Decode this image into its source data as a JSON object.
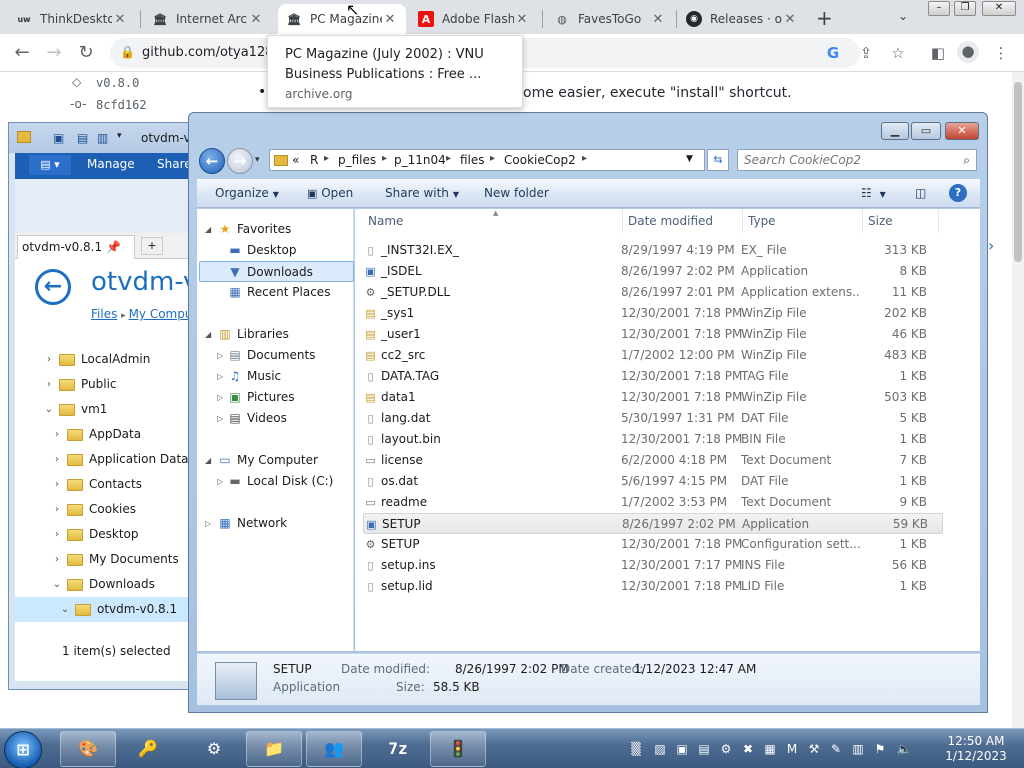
{
  "browser": {
    "tabs": [
      {
        "title": "ThinkDeskto",
        "favicon": "uw-icon"
      },
      {
        "title": "Internet Arch",
        "favicon": "archive-icon"
      },
      {
        "title": "PC Magazine",
        "favicon": "archive-icon"
      },
      {
        "title": "Adobe Flash",
        "favicon": "adobe-icon"
      },
      {
        "title": "FavesToGo",
        "favicon": "globe-icon"
      },
      {
        "title": "Releases · ot",
        "favicon": "github-icon"
      }
    ],
    "new_tab": "+",
    "url": "github.com/otya128",
    "tooltip": {
      "title": "PC Magazine (July 2002) : VNU Business Publications : Free ...",
      "domain": "archive.org"
    }
  },
  "github": {
    "tag": "v0.8.0",
    "commit": "8cfd162",
    "text": "ome easier, execute \"install\" shortcut."
  },
  "bg_explorer": {
    "ribbon_tabs": [
      "Manage",
      "Share"
    ],
    "title_fragment": "otvdm-v",
    "tab_label": "otvdm-v0.8.1",
    "add_tab": "+",
    "big_title": "otvdm-v0",
    "breadcrumb": [
      "Files",
      "My Comput"
    ],
    "tree": [
      {
        "label": "LocalAdmin",
        "depth": 0
      },
      {
        "label": "Public",
        "depth": 0
      },
      {
        "label": "vm1",
        "depth": 0
      },
      {
        "label": "AppData",
        "depth": 1
      },
      {
        "label": "Application Data",
        "depth": 1
      },
      {
        "label": "Contacts",
        "depth": 1
      },
      {
        "label": "Cookies",
        "depth": 1
      },
      {
        "label": "Desktop",
        "depth": 1
      },
      {
        "label": "My Documents",
        "depth": 1
      },
      {
        "label": "Downloads",
        "depth": 1
      },
      {
        "label": "otvdm-v0.8.1",
        "depth": 2
      }
    ],
    "status": "1 item(s) selected"
  },
  "explorer": {
    "breadcrumb": [
      "«",
      "R",
      "p_files",
      "p_11n04",
      "files",
      "CookieCop2"
    ],
    "search_placeholder": "Search CookieCop2",
    "commands": {
      "organize": "Organize",
      "open": "Open",
      "share_with": "Share with",
      "new_folder": "New folder"
    },
    "nav": {
      "favorites": "Favorites",
      "desktop": "Desktop",
      "downloads": "Downloads",
      "recent_places": "Recent Places",
      "libraries": "Libraries",
      "documents": "Documents",
      "music": "Music",
      "pictures": "Pictures",
      "videos": "Videos",
      "my_computer": "My Computer",
      "local_disk": "Local Disk (C:)",
      "network": "Network"
    },
    "columns": {
      "name": "Name",
      "date": "Date modified",
      "type": "Type",
      "size": "Size"
    },
    "files": [
      {
        "name": "_INST32I.EX_",
        "date": "8/29/1997 4:19 PM",
        "type": "EX_ File",
        "size": "313 KB",
        "icon": "file-icon"
      },
      {
        "name": "_ISDEL",
        "date": "8/26/1997 2:02 PM",
        "type": "Application",
        "size": "8 KB",
        "icon": "app-icon"
      },
      {
        "name": "_SETUP.DLL",
        "date": "8/26/1997 2:01 PM",
        "type": "Application extens...",
        "size": "11 KB",
        "icon": "dll-icon"
      },
      {
        "name": "_sys1",
        "date": "12/30/2001 7:18 PM",
        "type": "WinZip File",
        "size": "202 KB",
        "icon": "zip-icon"
      },
      {
        "name": "_user1",
        "date": "12/30/2001 7:18 PM",
        "type": "WinZip File",
        "size": "46 KB",
        "icon": "zip-icon"
      },
      {
        "name": "cc2_src",
        "date": "1/7/2002 12:00 PM",
        "type": "WinZip File",
        "size": "483 KB",
        "icon": "zip-icon"
      },
      {
        "name": "DATA.TAG",
        "date": "12/30/2001 7:18 PM",
        "type": "TAG File",
        "size": "1 KB",
        "icon": "file-icon"
      },
      {
        "name": "data1",
        "date": "12/30/2001 7:18 PM",
        "type": "WinZip File",
        "size": "503 KB",
        "icon": "zip-icon"
      },
      {
        "name": "lang.dat",
        "date": "5/30/1997 1:31 PM",
        "type": "DAT File",
        "size": "5 KB",
        "icon": "file-icon"
      },
      {
        "name": "layout.bin",
        "date": "12/30/2001 7:18 PM",
        "type": "BIN File",
        "size": "1 KB",
        "icon": "file-icon"
      },
      {
        "name": "license",
        "date": "6/2/2000 4:18 PM",
        "type": "Text Document",
        "size": "7 KB",
        "icon": "text-icon"
      },
      {
        "name": "os.dat",
        "date": "5/6/1997 4:15 PM",
        "type": "DAT File",
        "size": "1 KB",
        "icon": "file-icon"
      },
      {
        "name": "readme",
        "date": "1/7/2002 3:53 PM",
        "type": "Text Document",
        "size": "9 KB",
        "icon": "text-icon"
      },
      {
        "name": "SETUP",
        "date": "8/26/1997 2:02 PM",
        "type": "Application",
        "size": "59 KB",
        "icon": "app-icon",
        "selected": true
      },
      {
        "name": "SETUP",
        "date": "12/30/2001 7:18 PM",
        "type": "Configuration sett...",
        "size": "1 KB",
        "icon": "config-icon"
      },
      {
        "name": "setup.ins",
        "date": "12/30/2001 7:17 PM",
        "type": "INS File",
        "size": "56 KB",
        "icon": "file-icon"
      },
      {
        "name": "setup.lid",
        "date": "12/30/2001 7:18 PM",
        "type": "LID File",
        "size": "1 KB",
        "icon": "file-icon"
      }
    ],
    "details": {
      "name": "SETUP",
      "type": "Application",
      "modified_label": "Date modified:",
      "modified": "8/26/1997 2:02 PM",
      "created_label": "Date created:",
      "created": "1/12/2023 12:47 AM",
      "size_label": "Size:",
      "size": "58.5 KB"
    }
  },
  "taskbar": {
    "start": "⊞",
    "clock_time": "12:50 AM",
    "clock_date": "1/12/2023"
  }
}
